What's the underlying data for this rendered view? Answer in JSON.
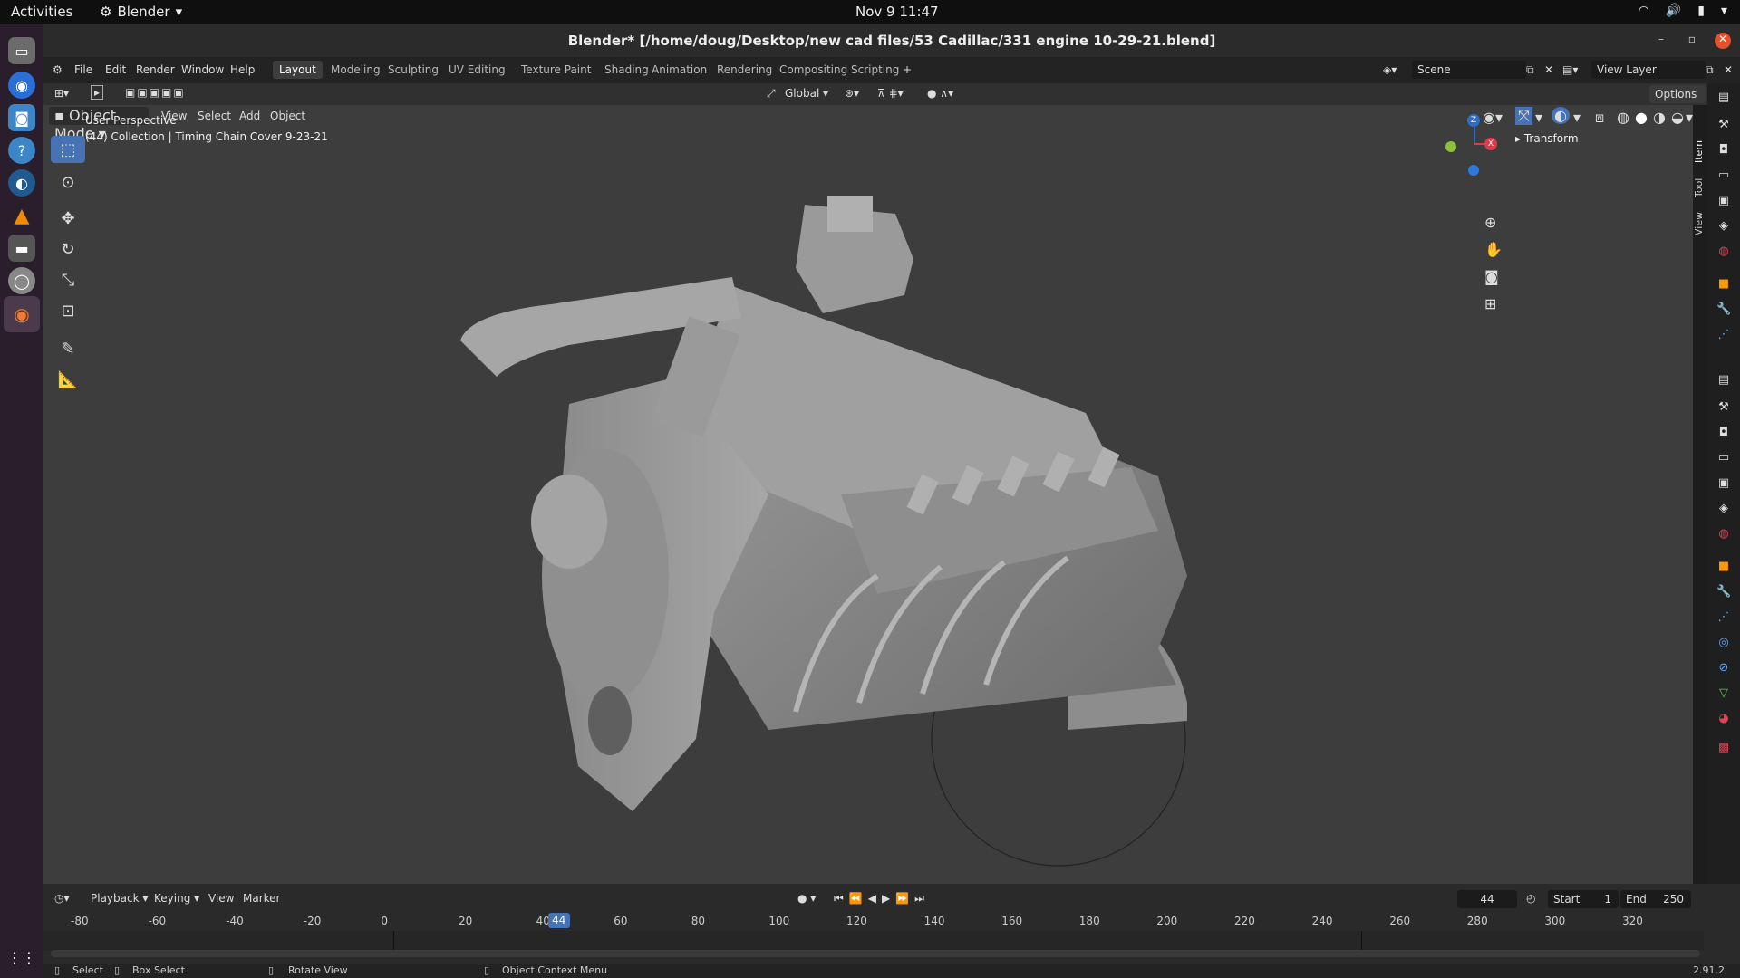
{
  "gnome": {
    "activities": "Activities",
    "app_name": "Blender",
    "clock": "Nov 9  11:47"
  },
  "window": {
    "title": "Blender* [/home/doug/Desktop/new cad files/53 Cadillac/331 engine 10-29-21.blend]"
  },
  "menu": {
    "file": "File",
    "edit": "Edit",
    "render": "Render",
    "window": "Window",
    "help": "Help"
  },
  "workspaces": [
    "Layout",
    "Modeling",
    "Sculpting",
    "UV Editing",
    "Texture Paint",
    "Shading",
    "Animation",
    "Rendering",
    "Compositing",
    "Scripting"
  ],
  "scene": {
    "name": "Scene",
    "view_layer": "View Layer"
  },
  "toolheader": {
    "orientation": "Global",
    "options": "Options"
  },
  "viewheader": {
    "mode": "Object Mode",
    "view": "View",
    "select": "Select",
    "add": "Add",
    "object": "Object"
  },
  "viewport": {
    "perspective": "User Perspective",
    "collection": "(44) Collection | Timing Chain Cover 9-23-21",
    "gizmo_z": "Z",
    "gizmo_x": "X"
  },
  "npanel": {
    "transform": "Transform",
    "tabs": [
      "Item",
      "Tool",
      "View"
    ]
  },
  "timeline": {
    "playback": "Playback",
    "keying": "Keying",
    "view": "View",
    "marker": "Marker",
    "current_frame": "44",
    "start_label": "Start",
    "start": "1",
    "end_label": "End",
    "end": "250",
    "ticks": [
      "-80",
      "-60",
      "-40",
      "-20",
      "0",
      "20",
      "40",
      "60",
      "80",
      "100",
      "120",
      "140",
      "160",
      "180",
      "200",
      "220",
      "240",
      "260",
      "280",
      "300",
      "320"
    ]
  },
  "status": {
    "select": "Select",
    "box_select": "Box Select",
    "rotate_view": "Rotate View",
    "context_menu": "Object Context Menu",
    "version": "2.91.2"
  },
  "colors": {
    "accent": "#4772b3",
    "viewport_bg": "#3d3d3d",
    "active_frame": "#4772b3"
  }
}
